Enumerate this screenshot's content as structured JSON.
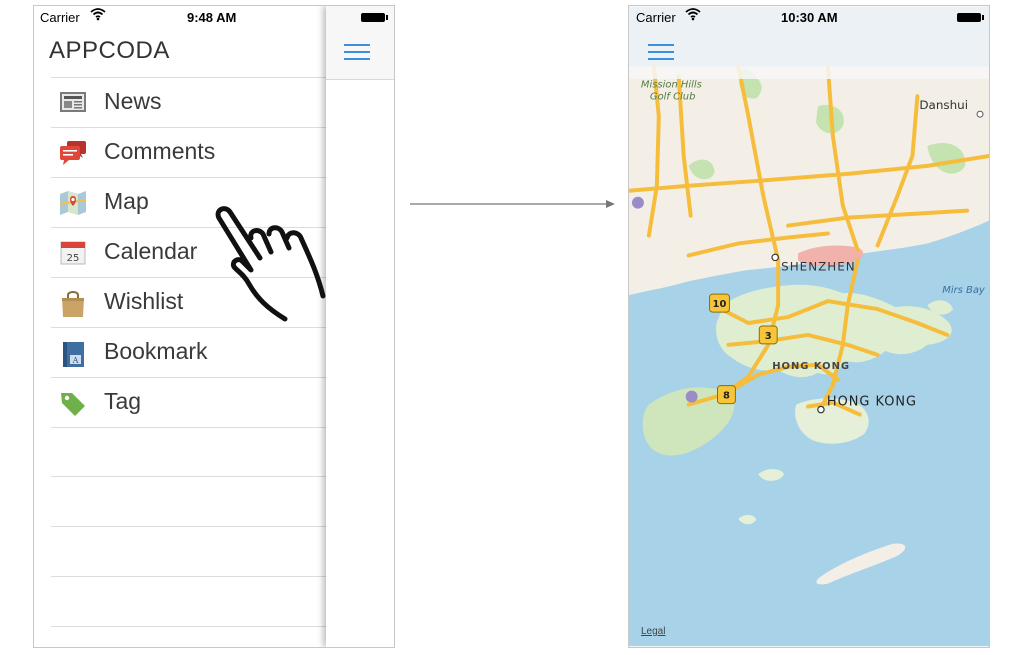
{
  "left_screen": {
    "status": {
      "carrier": "Carrier",
      "time": "9:48 AM"
    },
    "brand": "APPCODA",
    "menu": [
      {
        "label": "News",
        "icon": "newspaper-icon"
      },
      {
        "label": "Comments",
        "icon": "speech-bubbles-icon"
      },
      {
        "label": "Map",
        "icon": "map-icon"
      },
      {
        "label": "Calendar",
        "icon": "calendar-icon",
        "icon_text": "25"
      },
      {
        "label": "Wishlist",
        "icon": "shopping-bag-icon"
      },
      {
        "label": "Bookmark",
        "icon": "book-icon",
        "icon_text": "A"
      },
      {
        "label": "Tag",
        "icon": "tag-icon"
      }
    ]
  },
  "right_screen": {
    "status": {
      "carrier": "Carrier",
      "time": "10:30 AM"
    },
    "map_labels": {
      "golf": "Mission Hills\nGolf Club",
      "danshui": "Danshui",
      "shenzhen": "SHENZHEN",
      "mirs_bay": "Mirs Bay",
      "hong_kong_region": "HONG KONG",
      "hong_kong_city": "HONG KONG",
      "route_10": "10",
      "route_3": "3",
      "route_8": "8",
      "legal": "Legal"
    }
  },
  "colors": {
    "accent": "#3c8fdc",
    "sea": "#a7d2e8",
    "land": "#f3efe6",
    "road": "#f6bd3c",
    "park": "#c4e3b0"
  }
}
